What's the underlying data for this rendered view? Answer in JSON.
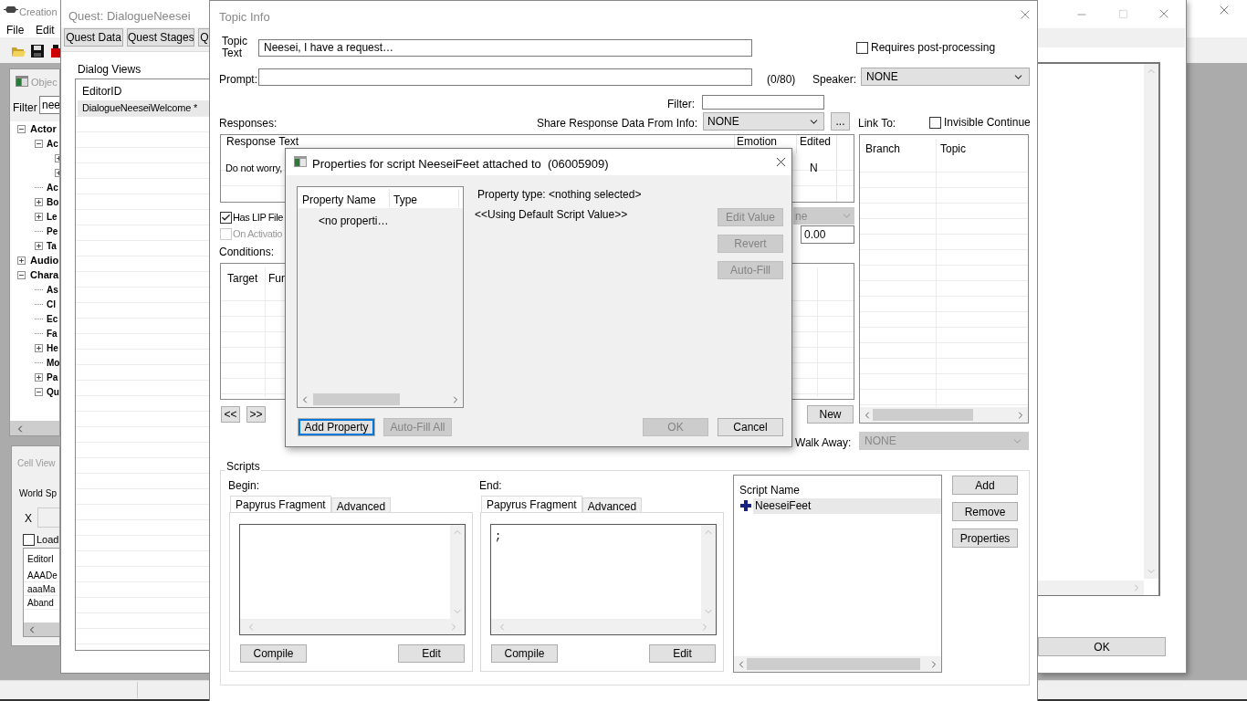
{
  "main_window": {
    "title": "Creation",
    "menu": [
      "File",
      "Edit"
    ]
  },
  "object_window": {
    "title": "Objec",
    "filter_label": "Filter",
    "filter_value": "nee",
    "tree": [
      {
        "label": "Actor",
        "kind": "folder",
        "expanded": true,
        "children": [
          {
            "label": "Ac",
            "kind": "folder",
            "expanded": true,
            "children": [
              {
                "kind": "folder",
                "expanded": false
              },
              {
                "kind": "folder",
                "expanded": false
              }
            ]
          },
          {
            "label": "Ac",
            "kind": "leaf"
          },
          {
            "label": "Bo",
            "kind": "folder",
            "expanded": false
          },
          {
            "label": "Le",
            "kind": "folder",
            "expanded": false
          },
          {
            "label": "Pe",
            "kind": "leaf"
          },
          {
            "label": "Ta",
            "kind": "folder",
            "expanded": false
          }
        ]
      },
      {
        "label": "Audio",
        "kind": "folder",
        "expanded": false
      },
      {
        "label": "Chara",
        "kind": "folder",
        "expanded": true,
        "children": [
          {
            "label": "As",
            "kind": "leaf"
          },
          {
            "label": "Cl",
            "kind": "leaf"
          },
          {
            "label": "Ec",
            "kind": "leaf"
          },
          {
            "label": "Fa",
            "kind": "leaf"
          },
          {
            "label": "He",
            "kind": "folder",
            "expanded": false
          },
          {
            "label": "Mo",
            "kind": "leaf"
          },
          {
            "label": "Pa",
            "kind": "folder",
            "expanded": false
          },
          {
            "label": "Qu",
            "kind": "folder",
            "expanded": true
          }
        ]
      }
    ]
  },
  "cell_view": {
    "title": "Cell View",
    "worldspace_label": "World Sp",
    "x_label": "X",
    "load": {
      "label": "Load",
      "checked": false
    },
    "list": {
      "header": "EditorI",
      "rows": [
        "AAADe",
        "aaaMa",
        "Aband"
      ]
    }
  },
  "quest_window": {
    "title": "Quest: DialogueNeesei",
    "tabs": [
      {
        "label": "Quest Data",
        "selected": false
      },
      {
        "label": "Quest Stages",
        "selected": false
      },
      {
        "label": "Q",
        "selected": false
      }
    ],
    "dialog_views_label": "Dialog Views",
    "list": {
      "header": "EditorID",
      "rows": [
        {
          "label": "DialogueNeeseiWelcome *",
          "selected": true
        }
      ]
    }
  },
  "side_window": {
    "ok_button": "OK"
  },
  "topic_info": {
    "title": "Topic Info",
    "topic_text_label": "Topic Text",
    "topic_text": "Neesei, I have a request…",
    "requires_post_processing": {
      "label": "Requires post-processing",
      "checked": false
    },
    "prompt_label": "Prompt:",
    "prompt_counter": "(0/80)",
    "speaker_label": "Speaker:",
    "speaker": "NONE",
    "filter_label": "Filter:",
    "responses_label": "Responses:",
    "share_label": "Share Response Data From Info:",
    "share_value": "NONE",
    "browse_button": "...",
    "link_to_label": "Link To:",
    "invisible_continue": {
      "label": "Invisible Continue",
      "checked": false
    },
    "responses": {
      "columns": [
        "Response Text",
        "Emotion",
        "Edited"
      ],
      "rows": [
        {
          "text": "Do not worry,",
          "edited": "N"
        }
      ]
    },
    "links": {
      "columns": [
        "Branch",
        "Topic"
      ]
    },
    "has_lip_file": {
      "label": "Has LIP File",
      "checked": true,
      "disabled": false
    },
    "on_activation": {
      "label": "On Activatio",
      "checked": false,
      "disabled": true
    },
    "emotion_select": "ne",
    "emotion_value": "0.00",
    "conditions_label": "Conditions:",
    "conditions": {
      "columns": [
        "Target",
        "Fun"
      ]
    },
    "nav_buttons": [
      "<<",
      ">>"
    ],
    "new_button": "New",
    "walk_away_label": "Walk Away:",
    "walk_away": "NONE",
    "scripts": {
      "title": "Scripts",
      "fragments": [
        {
          "label": "Begin:",
          "tabs": [
            {
              "label": "Papyrus Fragment",
              "selected": true
            },
            {
              "label": "Advanced",
              "selected": false
            }
          ],
          "buttons": [
            "Compile",
            "Edit"
          ]
        },
        {
          "label": "End:",
          "tabs": [
            {
              "label": "Papyrus Fragment",
              "selected": true
            },
            {
              "label": "Advanced",
              "selected": false
            }
          ],
          "code": ";",
          "buttons": [
            "Compile",
            "Edit"
          ]
        }
      ],
      "list": {
        "header": "Script Name",
        "rows": [
          {
            "name": "NeeseiFeet",
            "selected": true
          }
        ]
      },
      "buttons": [
        "Add",
        "Remove",
        "Properties"
      ]
    }
  },
  "properties_dialog": {
    "title": "Properties for script NeeseiFeet attached to  (06005909)",
    "columns": [
      "Property Name",
      "Type"
    ],
    "rows": [
      "<no properti…"
    ],
    "property_type": "Property type: <nothing selected>",
    "default_note": "<<Using Default Script Value>>",
    "side_buttons": [
      {
        "label": "Edit Value",
        "disabled": true
      },
      {
        "label": "Revert",
        "disabled": true
      },
      {
        "label": "Auto-Fill",
        "disabled": true
      }
    ],
    "bottom_buttons": [
      {
        "label": "Add Property",
        "disabled": false,
        "focused": true
      },
      {
        "label": "Auto-Fill All",
        "disabled": true,
        "focused": false
      },
      {
        "label": "OK",
        "disabled": true,
        "focused": false
      },
      {
        "label": "Cancel",
        "disabled": false,
        "focused": false
      }
    ]
  }
}
